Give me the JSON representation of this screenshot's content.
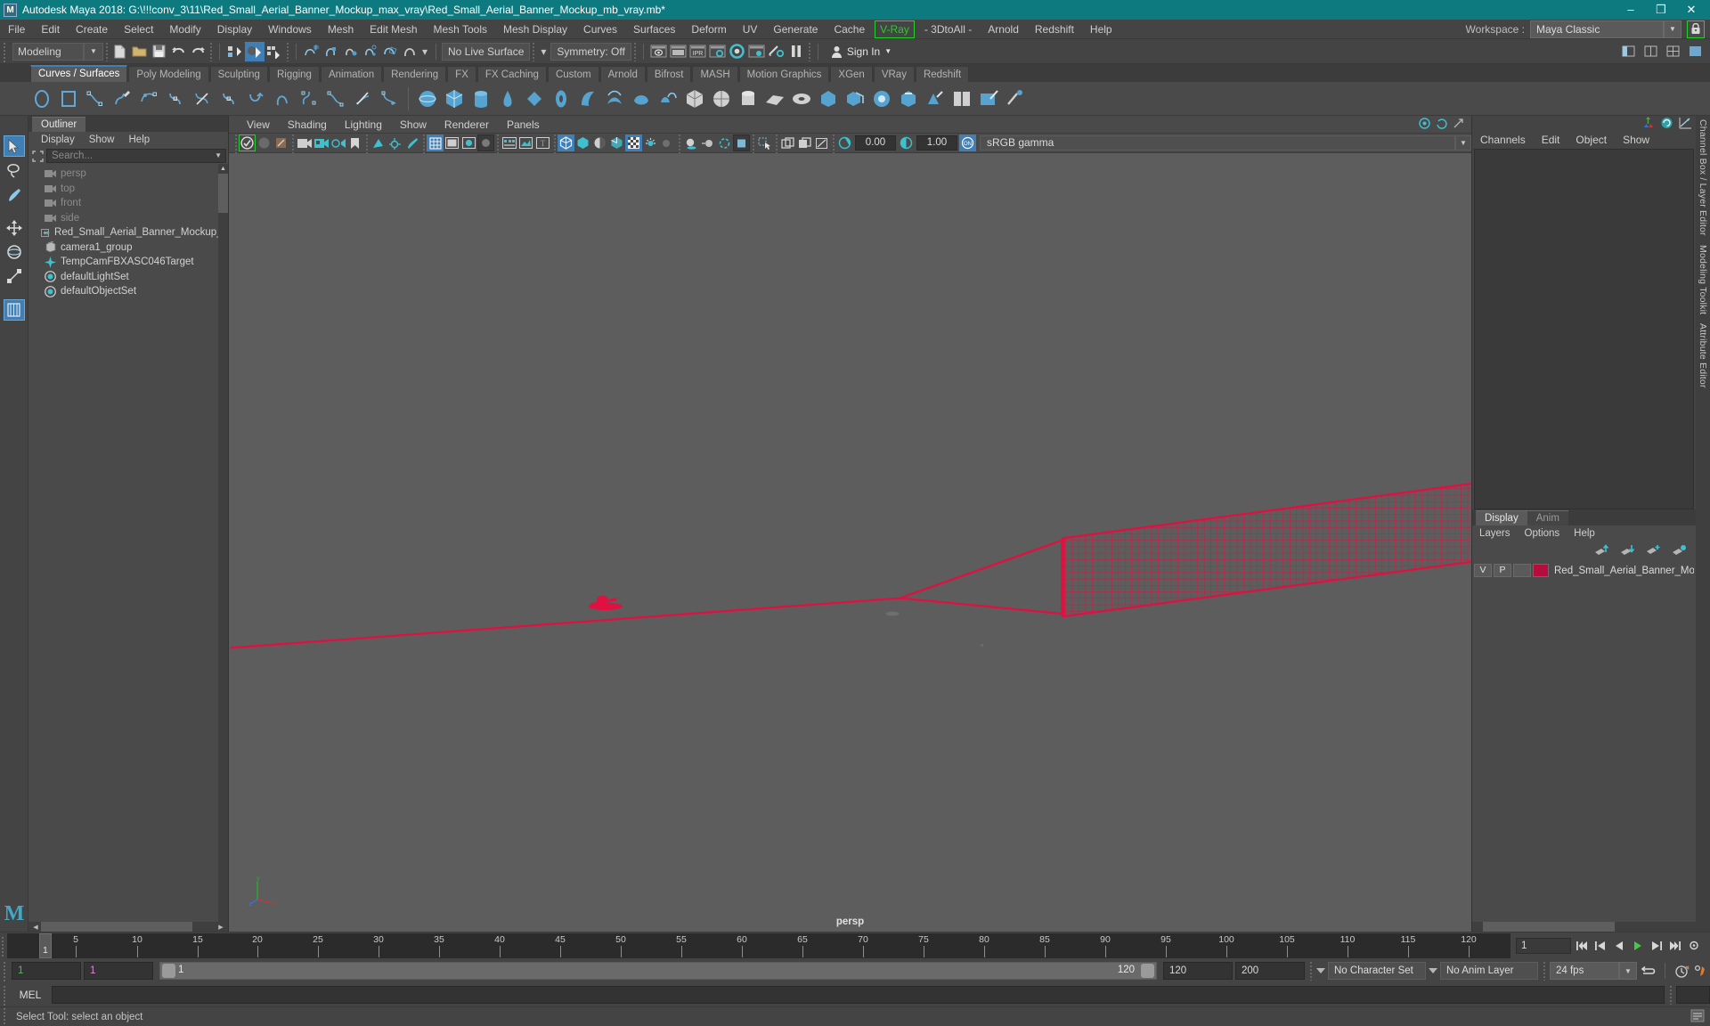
{
  "window": {
    "title": "Autodesk Maya 2018: G:\\!!!conv_3\\11\\Red_Small_Aerial_Banner_Mockup_max_vray\\Red_Small_Aerial_Banner_Mockup_mb_vray.mb*",
    "app_icon": "maya-icon",
    "minimize": "–",
    "maximize": "❐",
    "close": "✕",
    "titlebar_color": "#0d7a80"
  },
  "menubar": {
    "items": [
      {
        "label": "File"
      },
      {
        "label": "Edit"
      },
      {
        "label": "Create"
      },
      {
        "label": "Select"
      },
      {
        "label": "Modify"
      },
      {
        "label": "Display"
      },
      {
        "label": "Windows"
      },
      {
        "label": "Mesh"
      },
      {
        "label": "Edit Mesh"
      },
      {
        "label": "Mesh Tools"
      },
      {
        "label": "Mesh Display"
      },
      {
        "label": "Curves"
      },
      {
        "label": "Surfaces"
      },
      {
        "label": "Deform"
      },
      {
        "label": "UV"
      },
      {
        "label": "Generate"
      },
      {
        "label": "Cache"
      },
      {
        "label": "V-Ray",
        "highlight": true
      },
      {
        "label": "- 3DtoAll -"
      },
      {
        "label": "Arnold"
      },
      {
        "label": "Redshift"
      },
      {
        "label": "Help"
      }
    ],
    "workspace_label": "Workspace :",
    "workspace_value": "Maya Classic",
    "lock_icon": "lock-icon",
    "highlight_color": "#25d02a"
  },
  "statusline": {
    "mode": "Modeling",
    "live_surface": "No Live Surface",
    "symmetry": "Symmetry: Off",
    "sign_in": "Sign In"
  },
  "shelf": {
    "tabs": [
      "Curves / Surfaces",
      "Poly Modeling",
      "Sculpting",
      "Rigging",
      "Animation",
      "Rendering",
      "FX",
      "FX Caching",
      "Custom",
      "Arnold",
      "Bifrost",
      "MASH",
      "Motion Graphics",
      "XGen",
      "VRay",
      "Redshift"
    ],
    "selected_tab": "Curves / Surfaces"
  },
  "toolbox": {
    "items": [
      {
        "name": "select-tool",
        "selected": true
      },
      {
        "name": "lasso-select-tool",
        "selected": false
      },
      {
        "name": "paint-select-tool",
        "selected": false
      },
      {
        "name": "move-tool",
        "selected": false
      },
      {
        "name": "rotate-tool",
        "selected": false
      },
      {
        "name": "scale-tool",
        "selected": false
      },
      {
        "name": "last-tool",
        "selected": true
      }
    ]
  },
  "outliner": {
    "tab": "Outliner",
    "menus": [
      "Display",
      "Show",
      "Help"
    ],
    "search_placeholder": "Search...",
    "items": [
      {
        "label": "persp",
        "icon": "camera-icon",
        "dim": true,
        "expander": false
      },
      {
        "label": "top",
        "icon": "camera-icon",
        "dim": true,
        "expander": false
      },
      {
        "label": "front",
        "icon": "camera-icon",
        "dim": true,
        "expander": false
      },
      {
        "label": "side",
        "icon": "camera-icon",
        "dim": true,
        "expander": false
      },
      {
        "label": "Red_Small_Aerial_Banner_Mockup_n",
        "icon": "transform-icon",
        "dim": false,
        "expander": true
      },
      {
        "label": "camera1_group",
        "icon": "group-icon",
        "dim": false,
        "expander": false
      },
      {
        "label": "TempCamFBXASC046Target",
        "icon": "transform-icon",
        "dim": false,
        "expander": false
      },
      {
        "label": "defaultLightSet",
        "icon": "set-icon",
        "dim": false,
        "expander": false
      },
      {
        "label": "defaultObjectSet",
        "icon": "set-icon",
        "dim": false,
        "expander": false
      }
    ]
  },
  "viewport": {
    "menus": [
      "View",
      "Shading",
      "Lighting",
      "Show",
      "Renderer",
      "Panels"
    ],
    "exposure": "0.00",
    "gamma": "1.00",
    "color_management": "sRGB gamma",
    "camera_label": "persp",
    "background_color": "#5d5d5d",
    "model_color": "#e01040"
  },
  "channelbox": {
    "menus": [
      "Channels",
      "Edit",
      "Object",
      "Show"
    ]
  },
  "layers": {
    "tabs": [
      "Display",
      "Anim"
    ],
    "selected_tab": "Display",
    "menus": [
      "Layers",
      "Options",
      "Help"
    ],
    "rows": [
      {
        "v": "V",
        "p": "P",
        "color": "#b50e3e",
        "name": "Red_Small_Aerial_Banner_Moc"
      }
    ]
  },
  "vertical_tabs": [
    "Channel Box / Layer Editor",
    "Modeling Toolkit",
    "Attribute Editor"
  ],
  "timeline": {
    "ticks": [
      5,
      10,
      15,
      20,
      25,
      30,
      35,
      40,
      45,
      50,
      55,
      60,
      65,
      70,
      75,
      80,
      85,
      90,
      95,
      100,
      105,
      110,
      115,
      120
    ],
    "start": 1,
    "end": 120,
    "current_frame": "1",
    "current_frame_field": "1"
  },
  "rangeslider": {
    "anim_start": "1",
    "range_start": "1",
    "slider_min_label": "1",
    "slider_max_label": "120",
    "range_end": "120",
    "anim_end": "200",
    "character_set": "No Character Set",
    "anim_layer": "No Anim Layer",
    "fps": "24 fps"
  },
  "command_line": {
    "label": "MEL",
    "value": "",
    "placeholder": ""
  },
  "status_bar": {
    "message": "Select Tool: select an object"
  }
}
